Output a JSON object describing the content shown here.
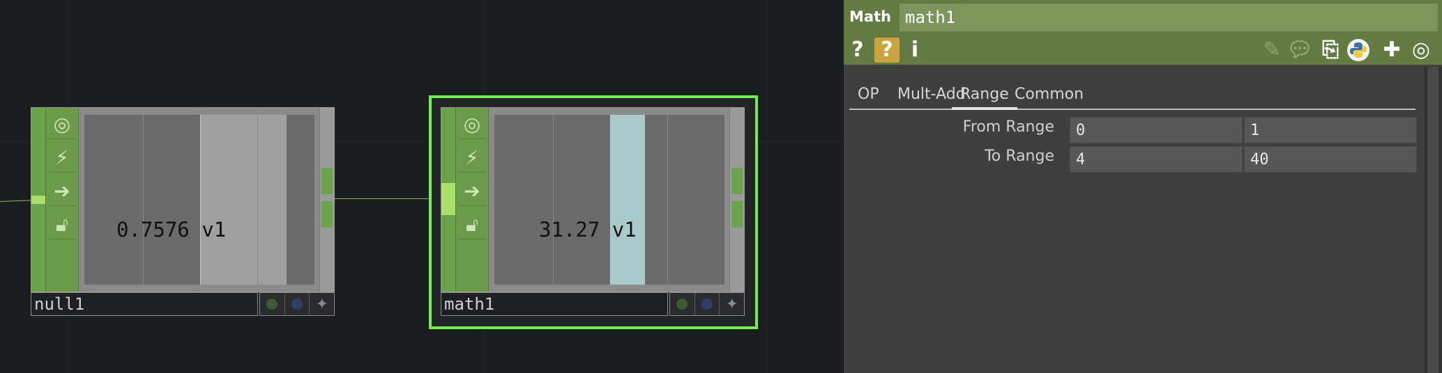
{
  "network": {
    "nodes": {
      "null1": {
        "name": "null1",
        "value": "0.7576",
        "channel": "v1"
      },
      "math1": {
        "name": "math1",
        "value": "31.27",
        "channel": "v1"
      }
    },
    "flag_icons": [
      "viewer-flag-icon",
      "bypass-flag-icon",
      "export-flag-icon",
      "lock-flag-icon"
    ],
    "colors": {
      "node_green": "#6aa34a",
      "selection": "#6ff24a",
      "math_bar": "#a9c9cb",
      "null_bar": "#a0a0a0"
    }
  },
  "panel": {
    "op_type": "Math",
    "op_name": "math1",
    "header_icons": {
      "help": "?",
      "python_help": "?",
      "info": "i"
    },
    "tabs": [
      "OP",
      "Mult-Add",
      "Range",
      "Common"
    ],
    "active_tab": "Range",
    "params": [
      {
        "label": "From Range",
        "value1": "0",
        "value2": "1"
      },
      {
        "label": "To Range",
        "value1": "4",
        "value2": "40"
      }
    ]
  }
}
